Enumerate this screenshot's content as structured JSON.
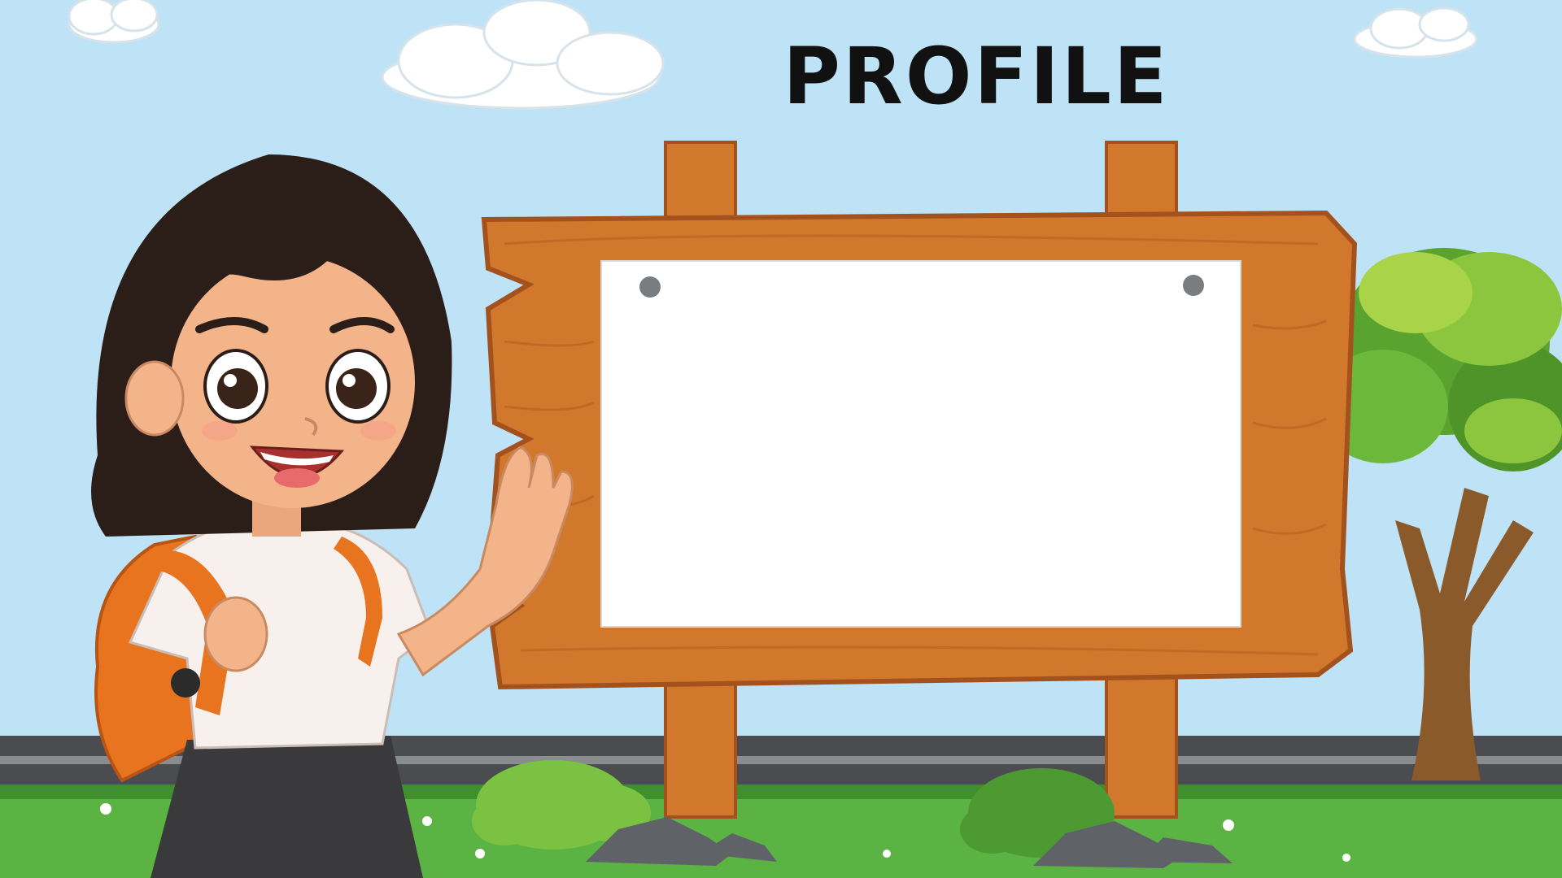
{
  "title": "PROFILE",
  "colors": {
    "sky": "#bfe3f6",
    "wood": "#d2782d",
    "wood_dark": "#a3521d",
    "grass": "#4fa83a",
    "road": "#4a4c50",
    "board": "#ffffff",
    "hair": "#2b1d18",
    "backpack": "#e8741f"
  },
  "icons": [
    "cloud-icon",
    "pin-icon",
    "tree-icon",
    "bush-icon",
    "rock-icon",
    "flower-icon",
    "student-character"
  ]
}
